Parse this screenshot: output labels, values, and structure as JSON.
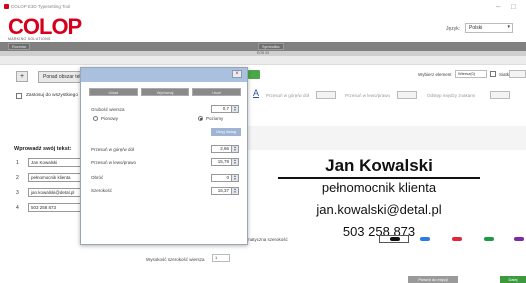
{
  "window": {
    "title": "COLOP E3D Typesetting Tool",
    "minimize": "–",
    "maximize": "□"
  },
  "brand": {
    "name": "COLOP",
    "tagline": "MARKING SOLUTIONS",
    "accent": "#d6001c"
  },
  "language": {
    "label": "Język:",
    "value": "Polski"
  },
  "strip": {
    "left_button": "Rozmiar",
    "center_button": "Symbolika"
  },
  "subbar": {
    "center_text": "EOS 03"
  },
  "left": {
    "start_button": "Ponad obszar tekstu",
    "apply_all_label": "Zastosuj do wszystkiego",
    "section_title": "Wprowadź swój tekst:",
    "lines": [
      {
        "num": "1",
        "text": "Jan Kowalski"
      },
      {
        "num": "2",
        "text": "pełnomocnik klienta"
      },
      {
        "num": "3",
        "text": "jan.kowalski@detal.pl"
      },
      {
        "num": "4",
        "text": "503 258 873"
      }
    ]
  },
  "dialog": {
    "tabs": [
      "Układ",
      "Wyrównaj",
      "Usuń"
    ],
    "line_size_label": "Grubość wiersza",
    "line_size_value": "0,7",
    "radio_vertical": "Pionowy",
    "radio_horizontal": "Poziomy",
    "reset_button": "Ukryj dialog",
    "shift_up_label": "Przesuń w górę/w dół",
    "shift_up_value": "2,86",
    "shift_left_label": "Przesuń w lewo/prawo",
    "shift_left_value": "15,79",
    "rotate_label": "Obróć",
    "rotate_value": "0",
    "width_label": "Szerokość",
    "width_value": "16,37"
  },
  "toolbar": {
    "element_label": "Wybierz element",
    "element_value": "Wiersz(0)",
    "size_label": "Siatka",
    "shift_updown_label": "Przesuń w górę/w dół",
    "shift_leftright_label": "Przesuń w lewo/prawo",
    "spacing_label": "Odstęp między znakami",
    "auto_width_label": "matyczna szerokość",
    "line_height_label": "Wysokość szerokość wiersza",
    "line_height_value": "1"
  },
  "preview": {
    "lines": [
      "Jan Kowalski",
      "pełnomocnik klienta",
      "jan.kowalski@detal.pl",
      "503 258 873"
    ]
  },
  "colors": {
    "swatches": [
      "#111111",
      "#2a7de1",
      "#e0283a",
      "#1e9a47",
      "#7b2aa3"
    ]
  },
  "footer": {
    "back_button": "Powrót do edycji",
    "next_button": "Dalej"
  }
}
